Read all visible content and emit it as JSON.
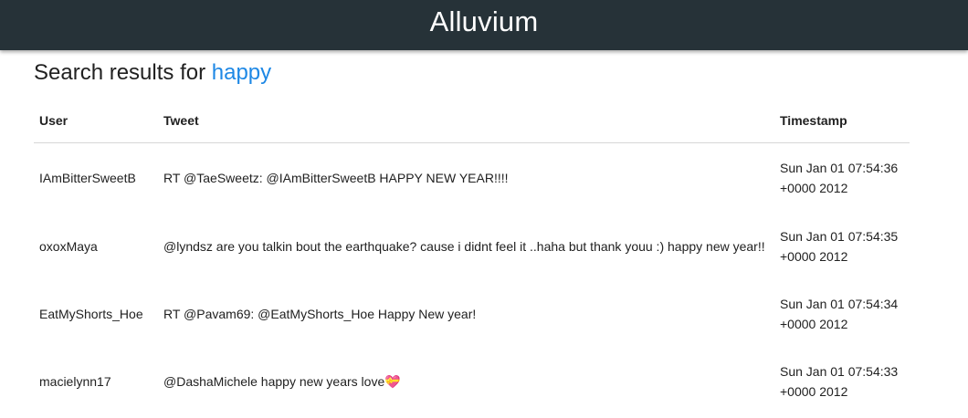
{
  "header": {
    "app_title": "Alluvium"
  },
  "search": {
    "heading_prefix": "Search results for ",
    "query": "happy"
  },
  "table": {
    "columns": [
      "User",
      "Tweet",
      "Timestamp"
    ],
    "rows": [
      {
        "user": "IAmBitterSweetB",
        "tweet": "RT @TaeSweetz: @IAmBitterSweetB HAPPY NEW YEAR!!!!",
        "timestamp": "Sun Jan 01 07:54:36 +0000 2012"
      },
      {
        "user": "oxoxMaya",
        "tweet": "@lyndsz are you talkin bout the earthquake? cause i didnt feel it ..haha but thank youu :) happy new year!!",
        "timestamp": "Sun Jan 01 07:54:35 +0000 2012"
      },
      {
        "user": "EatMyShorts_Hoe",
        "tweet": "RT @Pavam69: @EatMyShorts_Hoe Happy New year!",
        "timestamp": "Sun Jan 01 07:54:34 +0000 2012"
      },
      {
        "user": "macielynn17",
        "tweet": "@DashaMichele happy new years love💝",
        "timestamp": "Sun Jan 01 07:54:33 +0000 2012"
      }
    ]
  }
}
